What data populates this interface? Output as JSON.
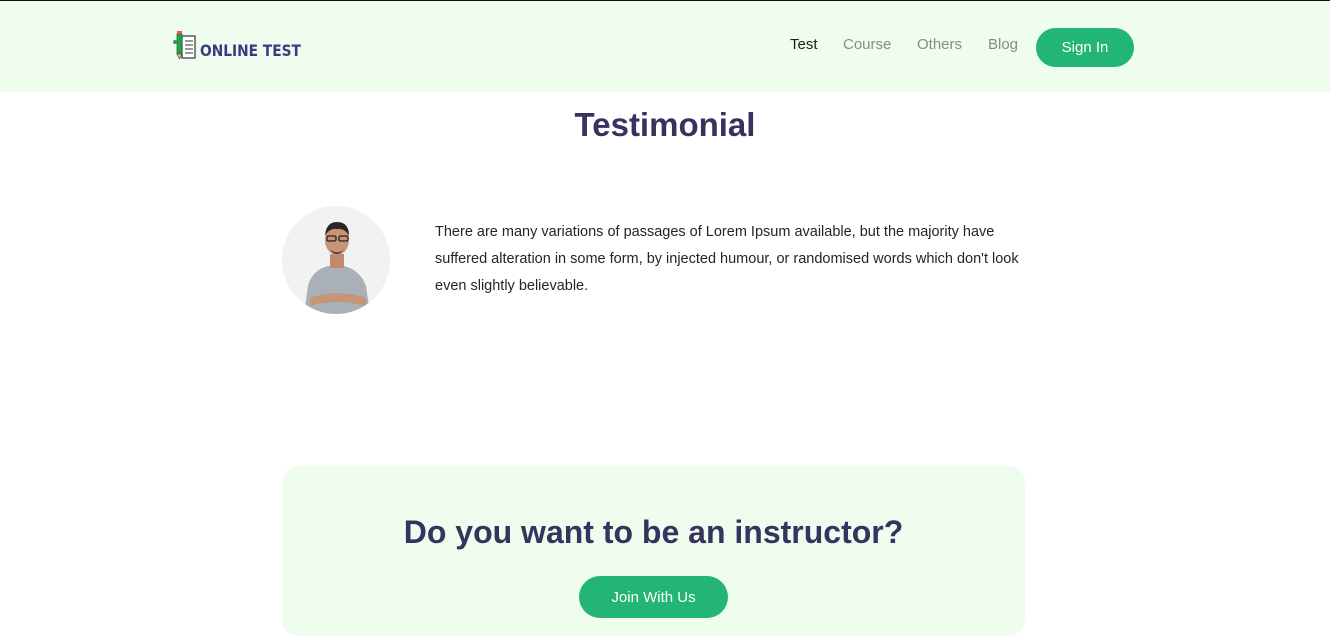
{
  "header": {
    "logo_text": "ONLINE TEST",
    "nav": [
      {
        "label": "Test",
        "active": true
      },
      {
        "label": "Course",
        "active": false
      },
      {
        "label": "Others",
        "active": false
      },
      {
        "label": "Blog",
        "active": false
      }
    ],
    "signin_label": "Sign In"
  },
  "testimonial": {
    "title": "Testimonial",
    "quote": "There are many variations of passages of Lorem Ipsum available, but the majority have suffered alteration in some form, by injected humour, or randomised words which don't look even slightly believable."
  },
  "cta": {
    "title": "Do you want to be an instructor?",
    "button_label": "Join With Us"
  },
  "colors": {
    "header_bg": "#effdef",
    "accent": "#22b573",
    "heading": "#36335f",
    "logo": "#3c3a85"
  }
}
